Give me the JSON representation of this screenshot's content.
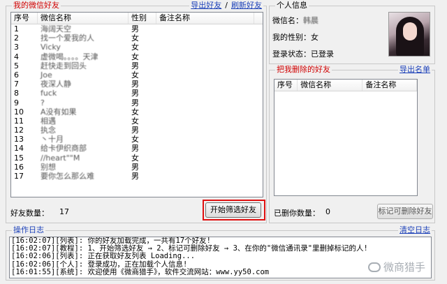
{
  "friends": {
    "title": "我的微信好友",
    "export_link": "导出好友",
    "separator": "/",
    "refresh_link": "刷新好友",
    "columns": [
      "序号",
      "微信名称",
      "性别",
      "备注名称"
    ],
    "rows": [
      {
        "idx": "1",
        "name": "海阔天空",
        "gender": "男",
        "note": ""
      },
      {
        "idx": "2",
        "name": "找一个爱我的人",
        "gender": "女",
        "note": ""
      },
      {
        "idx": "3",
        "name": "Vicky",
        "gender": "女",
        "note": ""
      },
      {
        "idx": "4",
        "name": "虚微喝。。。。天津",
        "gender": "女",
        "note": ""
      },
      {
        "idx": "5",
        "name": "赶快走到回头",
        "gender": "男",
        "note": ""
      },
      {
        "idx": "6",
        "name": "Joe",
        "gender": "女",
        "note": ""
      },
      {
        "idx": "7",
        "name": "夜深人静",
        "gender": "男",
        "note": ""
      },
      {
        "idx": "8",
        "name": "fuck",
        "gender": "男",
        "note": ""
      },
      {
        "idx": "9",
        "name": "?",
        "gender": "男",
        "note": ""
      },
      {
        "idx": "10",
        "name": "A没有如果",
        "gender": "女",
        "note": ""
      },
      {
        "idx": "11",
        "name": "相遇",
        "gender": "女",
        "note": ""
      },
      {
        "idx": "12",
        "name": "执念",
        "gender": "男",
        "note": ""
      },
      {
        "idx": "13",
        "name": "丶十月",
        "gender": "女",
        "note": ""
      },
      {
        "idx": "14",
        "name": "给卡伊织商部",
        "gender": "男",
        "note": ""
      },
      {
        "idx": "15",
        "name": "//heart\"\"M",
        "gender": "女",
        "note": ""
      },
      {
        "idx": "16",
        "name": "别想",
        "gender": "男",
        "note": ""
      },
      {
        "idx": "17",
        "name": "要你怎么那么难",
        "gender": "男",
        "note": ""
      }
    ],
    "count_label": "好友数量：",
    "count_value": "17",
    "start_button": "开始筛选好友"
  },
  "profile": {
    "title": "个人信息",
    "wechat_name_label": "微信名：",
    "wechat_name_value": "韩晨",
    "gender_label": "我的性别：",
    "gender_value": "女",
    "status_label": "登录状态：",
    "status_value": "已登录"
  },
  "deleted": {
    "title": "把我删除的好友",
    "export_link": "导出名单",
    "columns": [
      "序号",
      "微信名称",
      "备注名称"
    ],
    "count_label": "已删你数量：",
    "count_value": "0",
    "mark_button": "标记可删除好友"
  },
  "log": {
    "title": "操作日志",
    "clear_link": "清空日志",
    "lines": [
      "[16:02:07][列表]: 你的好友加载完成，一共有17个好友!",
      "[16:02:07][教程]: 1、开始筛选好友 → 2、标记可删除好友 → 3、在你的\"微信通讯录\"里删掉标记的人!",
      "[16:02:06][列表]: 正在获取好友列表 Loading...",
      "[16:02:06][个人]: 登录成功，正在加载个人信息!",
      "[16:01:55][系统]: 欢迎使用《微商猎手》，软件交流网站：www.yy50.com"
    ],
    "watermark": "微商猎手"
  },
  "colors": {
    "red_title": "#d00000",
    "blue_link": "#1a3fb8",
    "highlight": "#e01010"
  }
}
